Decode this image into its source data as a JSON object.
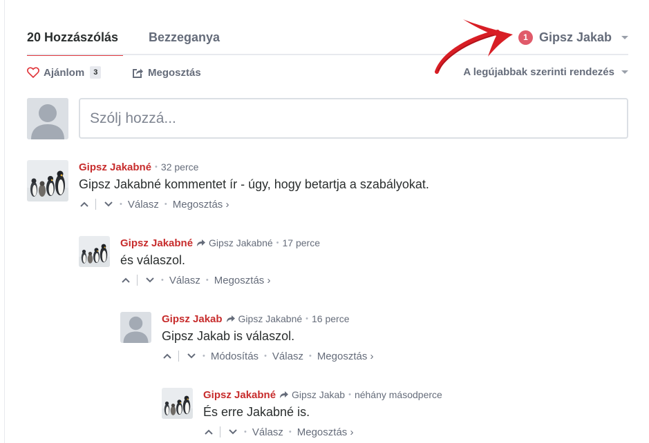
{
  "nav": {
    "comment_count_tab": "20 Hozzászólás",
    "community_tab": "Bezzeganya",
    "notification_count": "1",
    "user_name": "Gipsz Jakab"
  },
  "toolbar": {
    "recommend_label": "Ajánlom",
    "recommend_count": "3",
    "share_label": "Megosztás",
    "sort_label": "A legújabbak szerinti rendezés"
  },
  "composer": {
    "placeholder": "Szólj hozzá..."
  },
  "comments": [
    {
      "author": "Gipsz Jakabné",
      "reply_to": "",
      "time": "32 perce",
      "text": "Gipsz Jakabné kommentet ír - úgy, hogy betartja a szabályokat.",
      "avatar": "penguin-avatar",
      "actions": [
        "Válasz",
        "Megosztás ›"
      ]
    },
    {
      "author": "Gipsz Jakabné",
      "reply_to": "Gipsz Jakabné",
      "time": "17 perce",
      "text": "és válaszol.",
      "avatar": "penguin-avatar",
      "actions": [
        "Válasz",
        "Megosztás ›"
      ]
    },
    {
      "author": "Gipsz Jakab",
      "reply_to": "Gipsz Jakabné",
      "time": "16 perce",
      "text": "Gipsz Jakab is válaszol.",
      "avatar": "default-user-avatar",
      "actions": [
        "Módosítás",
        "Válasz",
        "Megosztás ›"
      ]
    },
    {
      "author": "Gipsz Jakabné",
      "reply_to": "Gipsz Jakab",
      "time": "néhány másodperce",
      "text": "És erre Jakabné is.",
      "avatar": "penguin-avatar",
      "actions": [
        "Válasz",
        "Megosztás ›"
      ]
    }
  ],
  "colors": {
    "accent_red": "#e0353b",
    "author_red": "#c72c2c",
    "badge": "#e05a6a",
    "muted": "#656c7a",
    "annotation_arrow": "#d81e25"
  }
}
